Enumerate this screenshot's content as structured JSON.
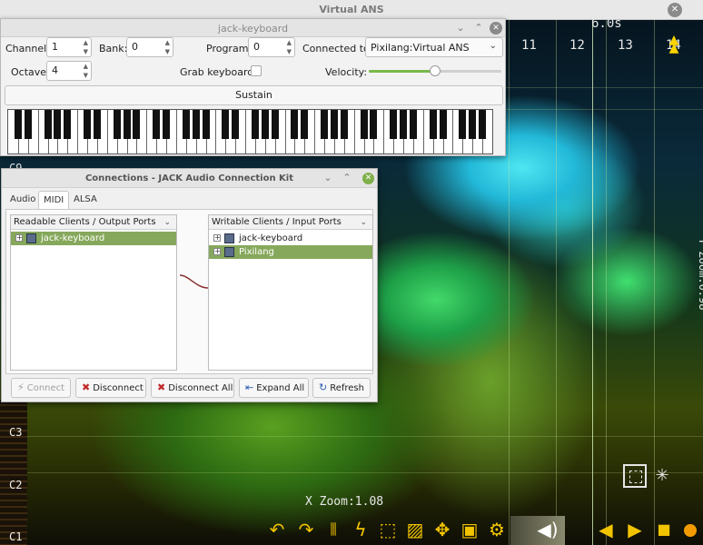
{
  "ans": {
    "title": "Virtual ANS",
    "close_glyph": "✕",
    "ticks": [
      "11",
      "12",
      "13",
      "14"
    ],
    "time_label": "6.0s",
    "y_zoom": "Y Zoom:0.98",
    "x_zoom": "X Zoom:1.08",
    "note_labels": [
      "C3",
      "C2",
      "C1"
    ],
    "top_partial_note": "C9",
    "toolbar_icons": [
      "undo-icon",
      "redo-icon",
      "equalizer-icon",
      "curve-icon",
      "selection-icon",
      "gradient-icon",
      "move-icon",
      "save-icon",
      "settings-icon",
      "volume-icon",
      "play-back-icon",
      "play-icon",
      "stop-icon",
      "record-icon"
    ],
    "accent_color": "#f2c400"
  },
  "jack_keyboard": {
    "title": "jack-keyboard",
    "channel_label": "Channel:",
    "channel_value": "1",
    "bank_label": "Bank:",
    "bank_value": "0",
    "program_label": "Program:",
    "program_value": "0",
    "connected_label": "Connected to:",
    "connected_value": "Pixilang:Virtual ANS",
    "octave_label": "Octave:",
    "octave_value": "4",
    "grab_label": "Grab keyboard:",
    "grab_checked": false,
    "velocity_label": "Velocity:",
    "velocity_level": 0.5,
    "sustain_label": "Sustain"
  },
  "connections": {
    "title": "Connections - JACK Audio Connection Kit",
    "tabs": [
      "Audio",
      "MIDI",
      "ALSA"
    ],
    "active_tab": "MIDI",
    "readable_header": "Readable Clients / Output Ports",
    "writable_header": "Writable Clients / Input Ports",
    "readable_clients": [
      {
        "name": "jack-keyboard",
        "selected": true
      }
    ],
    "writable_clients": [
      {
        "name": "jack-keyboard",
        "selected": false
      },
      {
        "name": "Pixilang",
        "selected": true
      }
    ],
    "buttons": {
      "connect": "Connect",
      "disconnect": "Disconnect",
      "disconnect_all": "Disconnect All",
      "expand_all": "Expand All",
      "refresh": "Refresh"
    },
    "selection_color": "#86a85c"
  }
}
